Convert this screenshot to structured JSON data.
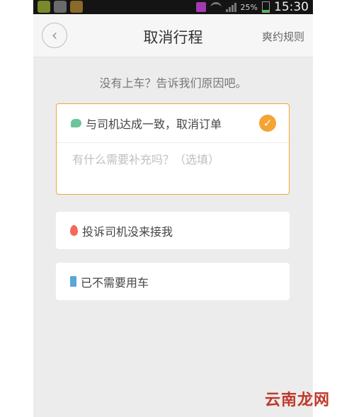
{
  "status_bar": {
    "battery": "25%",
    "time": "15:30"
  },
  "nav": {
    "title": "取消行程",
    "right_link": "爽约规则"
  },
  "prompt": "没有上车？告诉我们原因吧。",
  "reasons": [
    {
      "label": "与司机达成一致，取消订单",
      "icon": "chat-icon",
      "selected": true
    },
    {
      "label": "投诉司机没来接我",
      "icon": "fire-icon",
      "selected": false
    },
    {
      "label": "已不需要用车",
      "icon": "door-icon",
      "selected": false
    }
  ],
  "supplement_placeholder": "有什么需要补充吗？（选填）",
  "watermark": "云南龙网",
  "colors": {
    "accent": "#f5a433",
    "background": "#ececec"
  }
}
